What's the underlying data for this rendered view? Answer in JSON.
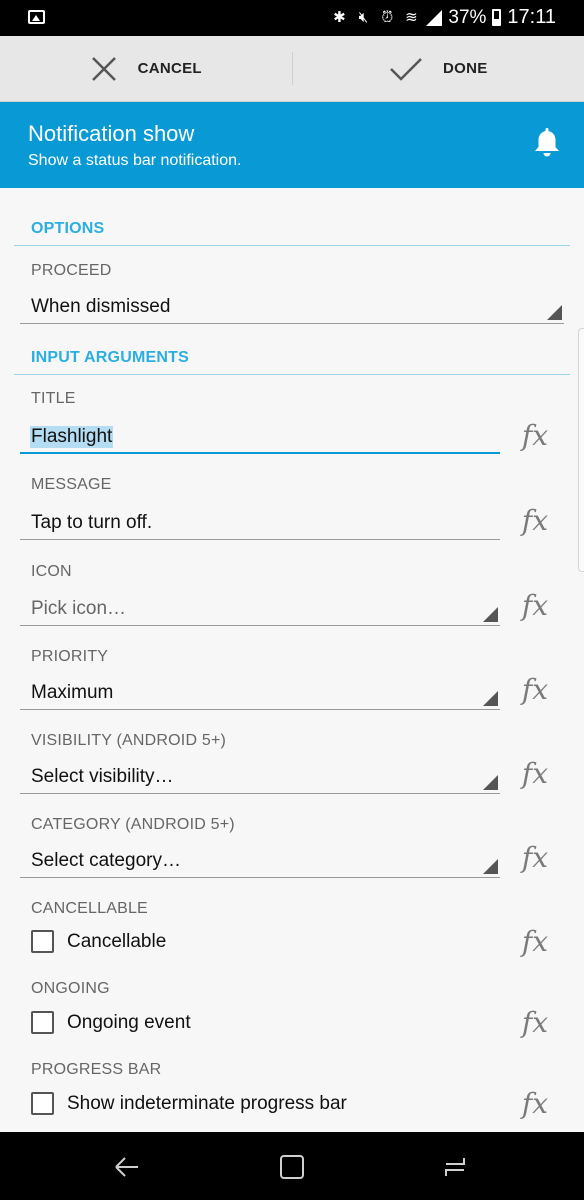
{
  "statusbar": {
    "battery": "37%",
    "time": "17:11",
    "icons": [
      "image-icon",
      "bluetooth-icon",
      "mute-icon",
      "alarm-icon",
      "wifi-icon",
      "signal-icon",
      "battery-icon"
    ]
  },
  "actionbar": {
    "cancel_label": "CANCEL",
    "done_label": "DONE"
  },
  "header": {
    "title": "Notification show",
    "subtitle": "Show a status bar notification.",
    "color": "#099ad5"
  },
  "options": {
    "section_title": "OPTIONS",
    "proceed_label": "PROCEED",
    "proceed_value": "When dismissed"
  },
  "inputs": {
    "section_title": "INPUT ARGUMENTS",
    "title_label": "TITLE",
    "title_value": "Flashlight",
    "message_label": "MESSAGE",
    "message_value": "Tap to turn off.",
    "icon_label": "ICON",
    "icon_placeholder": "Pick icon…",
    "priority_label": "PRIORITY",
    "priority_value": "Maximum",
    "visibility_label": "VISIBILITY (ANDROID 5+)",
    "visibility_value": "Select visibility…",
    "category_label": "CATEGORY (ANDROID 5+)",
    "category_value": "Select category…",
    "cancellable_label": "CANCELLABLE",
    "cancellable_check": "Cancellable",
    "ongoing_label": "ONGOING",
    "ongoing_check": "Ongoing event",
    "progress_label": "PROGRESS BAR",
    "progress_check": "Show indeterminate progress bar"
  },
  "fx_symbol": "fx"
}
